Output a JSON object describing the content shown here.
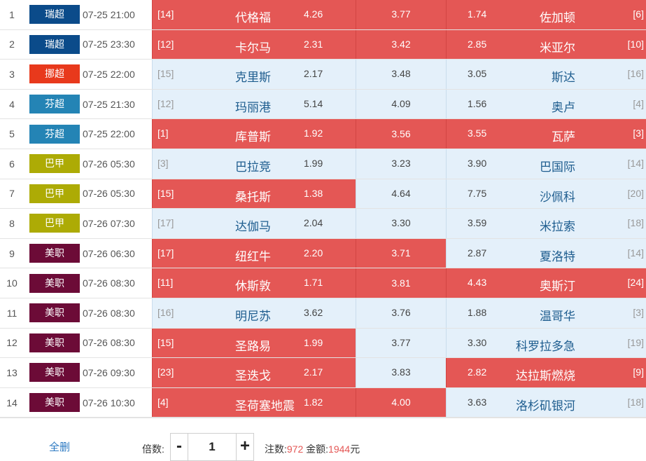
{
  "leagues": {
    "瑞超": "#0b4b8a",
    "挪超": "#e8391c",
    "芬超": "#2484b5",
    "巴甲": "#adab05",
    "美职": "#6c0b37"
  },
  "colors": {
    "selected": "#e45755",
    "unselected": "#e4f0fa",
    "highlight": "#e45755"
  },
  "matches": [
    {
      "num": "1",
      "league": "瑞超",
      "time": "07-25 21:00",
      "home_rank": "[14]",
      "home": "代格福",
      "home_odds": "4.26",
      "draw_odds": "3.77",
      "away_odds": "1.74",
      "away": "佐加顿",
      "away_rank": "[6]",
      "sel": [
        true,
        true,
        true
      ]
    },
    {
      "num": "2",
      "league": "瑞超",
      "time": "07-25 23:30",
      "home_rank": "[12]",
      "home": "卡尔马",
      "home_odds": "2.31",
      "draw_odds": "3.42",
      "away_odds": "2.85",
      "away": "米亚尔",
      "away_rank": "[10]",
      "sel": [
        true,
        true,
        true
      ]
    },
    {
      "num": "3",
      "league": "挪超",
      "time": "07-25 22:00",
      "home_rank": "[15]",
      "home": "克里斯",
      "home_odds": "2.17",
      "draw_odds": "3.48",
      "away_odds": "3.05",
      "away": "斯达",
      "away_rank": "[16]",
      "sel": [
        false,
        false,
        false
      ]
    },
    {
      "num": "4",
      "league": "芬超",
      "time": "07-25 21:30",
      "home_rank": "[12]",
      "home": "玛丽港",
      "home_odds": "5.14",
      "draw_odds": "4.09",
      "away_odds": "1.56",
      "away": "奥卢",
      "away_rank": "[4]",
      "sel": [
        false,
        false,
        false
      ]
    },
    {
      "num": "5",
      "league": "芬超",
      "time": "07-25 22:00",
      "home_rank": "[1]",
      "home": "库普斯",
      "home_odds": "1.92",
      "draw_odds": "3.56",
      "away_odds": "3.55",
      "away": "瓦萨",
      "away_rank": "[3]",
      "sel": [
        true,
        true,
        true
      ]
    },
    {
      "num": "6",
      "league": "巴甲",
      "time": "07-26 05:30",
      "home_rank": "[3]",
      "home": "巴拉竞",
      "home_odds": "1.99",
      "draw_odds": "3.23",
      "away_odds": "3.90",
      "away": "巴国际",
      "away_rank": "[14]",
      "sel": [
        false,
        false,
        false
      ]
    },
    {
      "num": "7",
      "league": "巴甲",
      "time": "07-26 05:30",
      "home_rank": "[15]",
      "home": "桑托斯",
      "home_odds": "1.38",
      "draw_odds": "4.64",
      "away_odds": "7.75",
      "away": "沙佩科",
      "away_rank": "[20]",
      "sel": [
        true,
        false,
        false
      ]
    },
    {
      "num": "8",
      "league": "巴甲",
      "time": "07-26 07:30",
      "home_rank": "[17]",
      "home": "达伽马",
      "home_odds": "2.04",
      "draw_odds": "3.30",
      "away_odds": "3.59",
      "away": "米拉索",
      "away_rank": "[18]",
      "sel": [
        false,
        false,
        false
      ]
    },
    {
      "num": "9",
      "league": "美职",
      "time": "07-26 06:30",
      "home_rank": "[17]",
      "home": "纽红牛",
      "home_odds": "2.20",
      "draw_odds": "3.71",
      "away_odds": "2.87",
      "away": "夏洛特",
      "away_rank": "[14]",
      "sel": [
        true,
        true,
        false
      ]
    },
    {
      "num": "10",
      "league": "美职",
      "time": "07-26 08:30",
      "home_rank": "[11]",
      "home": "休斯敦",
      "home_odds": "1.71",
      "draw_odds": "3.81",
      "away_odds": "4.43",
      "away": "奥斯汀",
      "away_rank": "[24]",
      "sel": [
        true,
        true,
        true
      ]
    },
    {
      "num": "11",
      "league": "美职",
      "time": "07-26 08:30",
      "home_rank": "[16]",
      "home": "明尼苏",
      "home_odds": "3.62",
      "draw_odds": "3.76",
      "away_odds": "1.88",
      "away": "温哥华",
      "away_rank": "[3]",
      "sel": [
        false,
        false,
        false
      ]
    },
    {
      "num": "12",
      "league": "美职",
      "time": "07-26 08:30",
      "home_rank": "[15]",
      "home": "圣路易",
      "home_odds": "1.99",
      "draw_odds": "3.77",
      "away_odds": "3.30",
      "away": "科罗拉多急",
      "away_rank": "[19]",
      "sel": [
        true,
        false,
        false
      ]
    },
    {
      "num": "13",
      "league": "美职",
      "time": "07-26 09:30",
      "home_rank": "[23]",
      "home": "圣迭戈",
      "home_odds": "2.17",
      "draw_odds": "3.83",
      "away_odds": "2.82",
      "away": "达拉斯燃烧",
      "away_rank": "[9]",
      "sel": [
        true,
        false,
        true
      ]
    },
    {
      "num": "14",
      "league": "美职",
      "time": "07-26 10:30",
      "home_rank": "[4]",
      "home": "圣荷塞地震",
      "home_odds": "1.82",
      "draw_odds": "4.00",
      "away_odds": "3.63",
      "away": "洛杉矶银河",
      "away_rank": "[18]",
      "sel": [
        true,
        true,
        false
      ]
    }
  ],
  "footer": {
    "clear_all": "全删",
    "multiplier_label": "倍数:",
    "minus": "-",
    "plus": "+",
    "multiplier_value": "1",
    "bets_label": "注数:",
    "bets_value": "972",
    "amount_label": "金额:",
    "amount_value": "1944",
    "amount_unit": "元"
  }
}
